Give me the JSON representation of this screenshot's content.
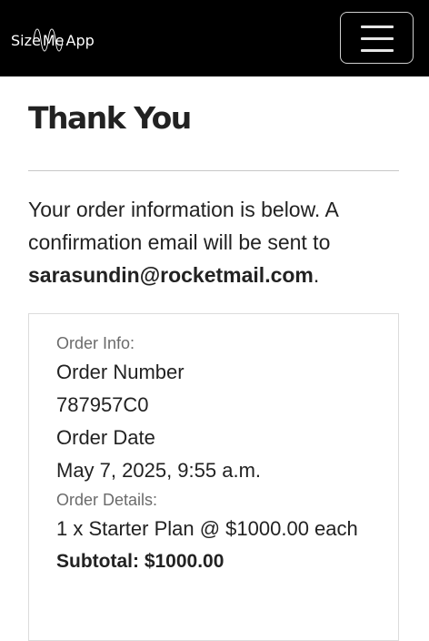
{
  "navbar": {
    "logo": {
      "part1": "Size",
      "part2": "Me",
      "part3": "App"
    },
    "menu_icon": "hamburger-menu-icon",
    "background_color": "#000000"
  },
  "page": {
    "title": "Thank You",
    "intro_text": "Your order information is below. A confirmation email will be sent to ",
    "email": "sarasundin@rocketmail.com",
    "intro_end": "."
  },
  "order": {
    "info_label": "Order Info:",
    "number_label": "Order Number",
    "number_value": "787957C0",
    "date_label": "Order Date",
    "date_value": "May 7, 2025, 9:55 a.m.",
    "details_label": "Order Details:",
    "line_item": "1 x Starter Plan @ $1000.00 each",
    "subtotal": "Subtotal: $1000.00"
  }
}
